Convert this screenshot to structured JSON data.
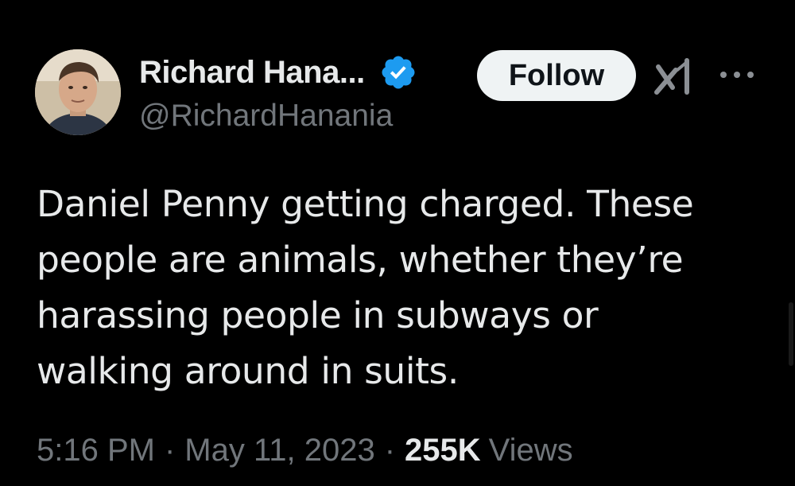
{
  "tweet": {
    "author": {
      "display_name": "Richard Hana...",
      "handle": "@RichardHanania",
      "verified": true
    },
    "follow_label": "Follow",
    "text_lines": [
      "Daniel Penny getting charged. These",
      "people are animals, whether they’re",
      "harassing people in subways or",
      "walking around in suits."
    ],
    "time": "5:16 PM",
    "separator": "·",
    "date": "May 11, 2023",
    "views_count": "255K",
    "views_label": "Views"
  },
  "icons": {
    "verified": "verified-badge-icon",
    "grok": "grok-icon",
    "more": "more-options-icon"
  },
  "colors": {
    "background": "#000000",
    "primary_text": "#e7e9ea",
    "secondary_text": "#71767b",
    "verified_blue": "#1d9bf0",
    "follow_bg": "#eff3f4"
  }
}
